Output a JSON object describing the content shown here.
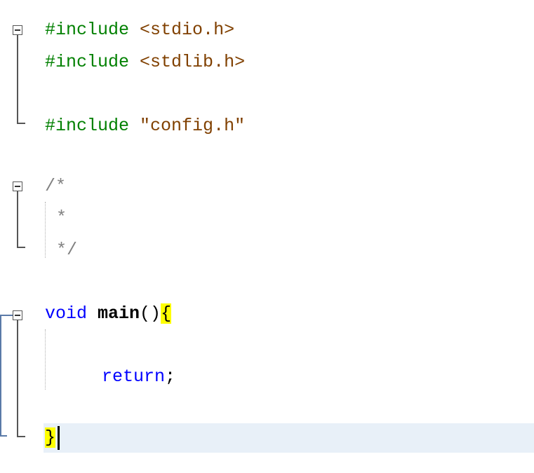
{
  "editor": {
    "lines": {
      "l1": {
        "directive": "#include",
        "file": "<stdio.h>"
      },
      "l2": {
        "directive": "#include",
        "file": "<stdlib.h>"
      },
      "l4": {
        "directive": "#include",
        "file": "\"config.h\""
      },
      "l6": {
        "comment": "/*"
      },
      "l7": {
        "comment": "*"
      },
      "l8": {
        "comment": "*/"
      },
      "l10": {
        "keyword": "void",
        "function": "main",
        "parens": "()",
        "brace_open": "{"
      },
      "l12": {
        "keyword": "return",
        "semicolon": ";"
      },
      "l14": {
        "brace_close": "}"
      }
    },
    "colors": {
      "preprocessor": "#008000",
      "include_file": "#804000",
      "comment": "#808080",
      "keyword": "#0000ff",
      "brace_match_highlight": "#ffff00",
      "current_line": "#e8f0f8"
    },
    "icons": {
      "fold": "minus-box-fold-icon"
    }
  }
}
